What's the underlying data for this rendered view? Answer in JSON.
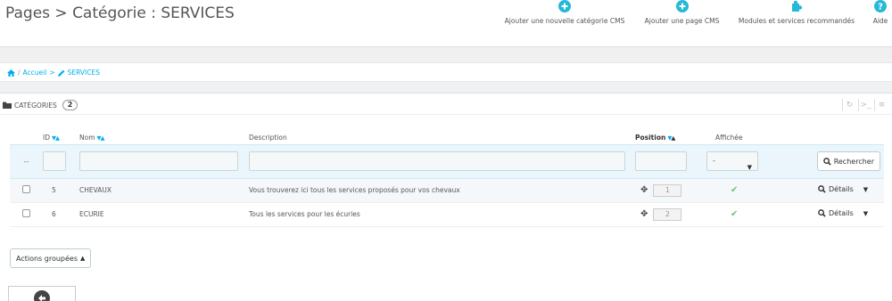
{
  "header": {
    "title": "Pages > Catégorie : SERVICES",
    "toolbar": [
      {
        "label": "Ajouter une nouvelle catégorie CMS",
        "icon": "plus-circle-icon"
      },
      {
        "label": "Ajouter une page CMS",
        "icon": "plus-circle-icon"
      },
      {
        "label": "Modules et services recommandés",
        "icon": "puzzle-icon"
      },
      {
        "label": "Aide",
        "icon": "question-circle-icon"
      }
    ]
  },
  "breadcrumb": {
    "sep": "/",
    "home": "Accueil",
    "arrow": ">",
    "current": "SERVICES"
  },
  "panel": {
    "title": "CATÉGORIES",
    "count": "2"
  },
  "table": {
    "headers": {
      "id": "ID",
      "name": "Nom",
      "description": "Description",
      "position": "Position",
      "displayed": "Affichée"
    },
    "filter": {
      "dash": "--",
      "displayed_value": "-",
      "search_label": "Rechercher"
    },
    "rows": [
      {
        "id": "5",
        "name": "CHEVAUX",
        "description": "Vous trouverez ici tous les services proposés pour vos chevaux",
        "position": "1",
        "displayed": true,
        "action": "Détails"
      },
      {
        "id": "6",
        "name": "ECURIE",
        "description": "Tous les services pour les écuries",
        "position": "2",
        "displayed": true,
        "action": "Détails"
      }
    ]
  },
  "bulk_actions": {
    "label": "Actions groupées"
  },
  "colors": {
    "accent": "#25b9d7",
    "link": "#00aff0",
    "check": "#72c279"
  }
}
